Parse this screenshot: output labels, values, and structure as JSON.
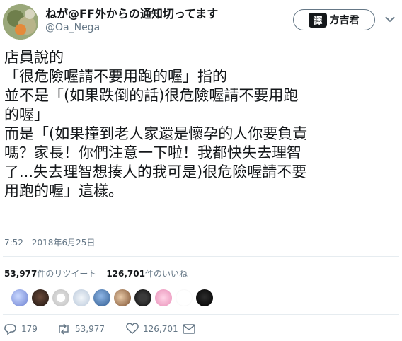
{
  "user": {
    "display_name": "ねが@FF外からの通知切ってます",
    "handle": "@Oa_Nega"
  },
  "follow_button": {
    "badge": "譯",
    "brand": "方吉君"
  },
  "tweet": {
    "lines": [
      "店員說的",
      "「很危險喔請不要用跑的喔」指的",
      "並不是「(如果跌倒的話)很危險喔請不要用跑",
      "的喔」",
      "而是「(如果撞到老人家還是懷孕的人你要負責",
      "嗎？家長！你們注意一下啦！我都快失去理智",
      "了...失去理智想揍人的我可是)很危險喔請不要",
      "用跑的喔」這樣。"
    ],
    "timestamp": "7:52 - 2018年6月25日"
  },
  "stats": {
    "retweets_count": "53,977",
    "retweets_label": "件のリツイート",
    "likes_count": "126,701",
    "likes_label": "件のいいね"
  },
  "actions": {
    "replies": "179",
    "retweets": "53,977",
    "likes": "126,701"
  },
  "colors": {
    "text": "#14171a",
    "secondary": "#657786",
    "divider": "#e6ecf0"
  }
}
